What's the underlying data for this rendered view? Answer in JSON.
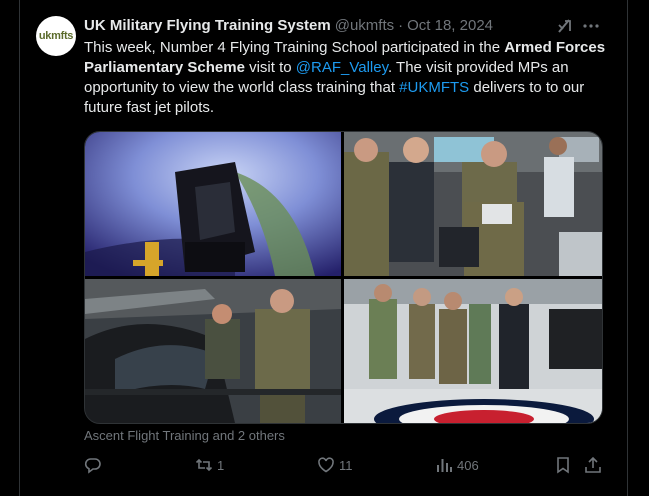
{
  "tweet": {
    "display_name": "UK Military Flying Training System",
    "handle": "@ukmfts",
    "separator": "·",
    "date": "Oct 18, 2024",
    "avatar_text": "ukmfts",
    "text": {
      "p1": "This week, Number 4 Flying Training School participated in the ",
      "bold": "Armed Forces Parliamentary Scheme",
      "p2": " visit to ",
      "mention": "@RAF_Valley",
      "p3": ". The visit provided MPs an opportunity to view the world class training that ",
      "hashtag": "#UKMFTS",
      "p4": " delivers to to our future fast jet pilots."
    },
    "tagged": "Ascent Flight Training and 2 others",
    "counts": {
      "replies": "",
      "retweets": "1",
      "likes": "11",
      "views": "406"
    }
  },
  "icons": {
    "grok": "grok-icon",
    "more": "more-icon",
    "reply": "reply-icon",
    "retweet": "retweet-icon",
    "like": "heart-icon",
    "views": "views-icon",
    "bookmark": "bookmark-icon",
    "share": "share-icon"
  },
  "colors": {
    "background": "#000000",
    "text": "#e7e9ea",
    "secondary": "#71767b",
    "link": "#1d9bf0",
    "border": "#2f3336"
  }
}
